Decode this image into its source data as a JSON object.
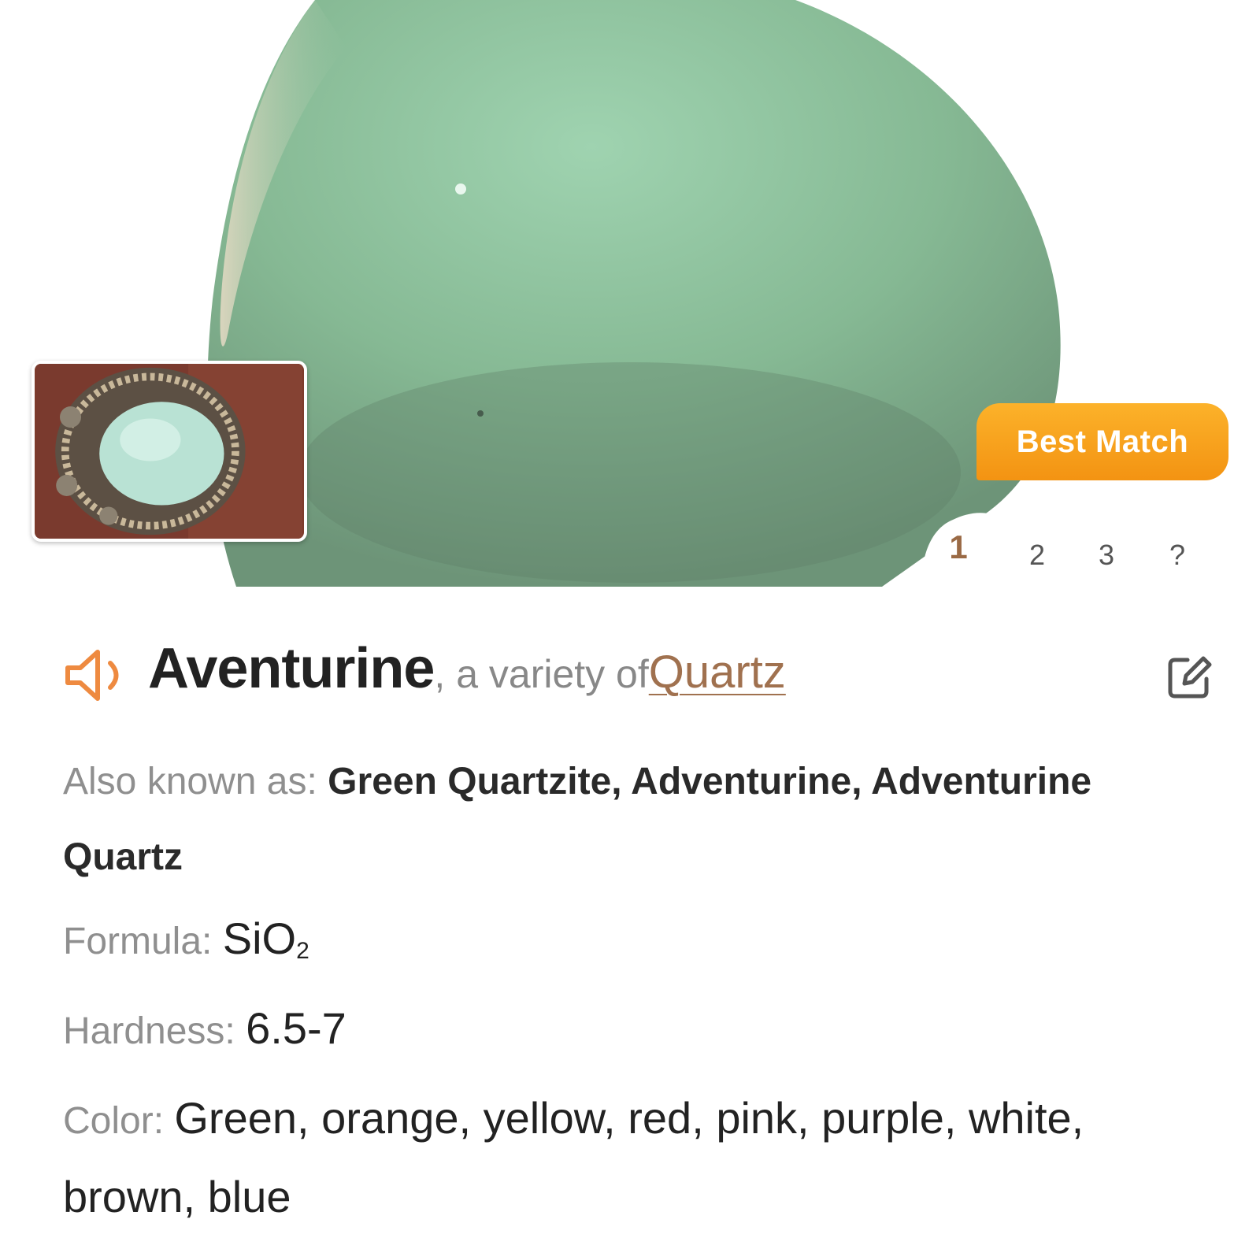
{
  "result": {
    "badge_label": "Best Match",
    "pages": [
      "1",
      "2",
      "3",
      "?"
    ],
    "active_page": "1"
  },
  "mineral": {
    "name": "Aventurine",
    "variety_text": ", a variety of ",
    "parent_mineral": "Quartz"
  },
  "details": {
    "aka_label": "Also known as: ",
    "aka_value": "Green Quartzite, Adventurine, Adventurine Quartz",
    "formula_label": "Formula: ",
    "formula_base": "SiO",
    "formula_subscript": "2",
    "hardness_label": "Hardness: ",
    "hardness_value": "6.5-7",
    "color_label": "Color: ",
    "color_value": "Green, orange, yellow, red, pink, purple, white, brown, blue"
  },
  "icons": {
    "speaker": "speaker-icon",
    "edit": "edit-icon"
  },
  "colors": {
    "accent_orange": "#f39312",
    "link_brown": "#a0714f",
    "stone_green": "#8cc09c"
  }
}
